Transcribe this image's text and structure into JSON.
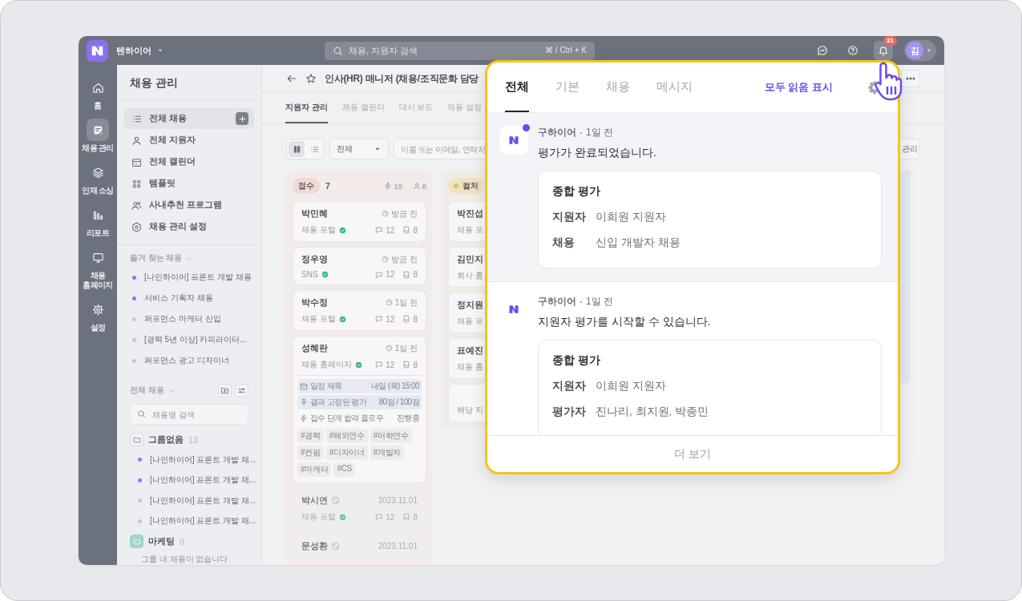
{
  "top_bar": {
    "workspace": "텐하이어",
    "search": {
      "placeholder": "채용, 지원자 검색",
      "shortcut": "⌘ / Ctrl + K"
    },
    "notification_count": "31",
    "avatar": "김"
  },
  "rail": [
    {
      "label": "홈",
      "selected": false
    },
    {
      "label": "채용 관리",
      "selected": true
    },
    {
      "label": "인재 소싱",
      "selected": false
    },
    {
      "label": "리포트",
      "selected": false
    },
    {
      "label": "채용 홈페이지",
      "selected": false
    },
    {
      "label": "설정",
      "selected": false
    }
  ],
  "sidebar": {
    "title": "채용 관리",
    "nav": [
      {
        "label": "전체 채용",
        "selected": true
      },
      {
        "label": "전체 지원자",
        "selected": false
      },
      {
        "label": "전체 캘린더",
        "selected": false
      },
      {
        "label": "템플릿",
        "selected": false
      },
      {
        "label": "사내추천 프로그램",
        "selected": false
      },
      {
        "label": "채용 관리 설정",
        "selected": false
      }
    ],
    "favorites": {
      "title": "즐겨 찾는 채용",
      "items": [
        {
          "label": "[나인하이어] 프론트 개발 채용",
          "color": "#8b7cf6"
        },
        {
          "label": "서비스 기획자 채용",
          "color": "#8b7cf6"
        },
        {
          "label": "퍼포먼스 마케터 신입",
          "color": "#c4c7cd"
        },
        {
          "label": "[경력 5년 이상] 카피라이터...",
          "color": "#c4c7cd"
        },
        {
          "label": "퍼포먼스 광고 디자이너",
          "color": "#c4c7cd"
        }
      ]
    },
    "all_jobs": {
      "title": "전체 채용",
      "search_placeholder": "채용명 검색",
      "groups": [
        {
          "name": "그룹없음",
          "count": "13",
          "kind": "plain",
          "items": [
            {
              "label": "[나인하이어] 프론트 개발 채...",
              "color": "#8b7cf6"
            },
            {
              "label": "[나인하이어] 프론트 개발 채...",
              "color": "#8b7cf6"
            },
            {
              "label": "[나인하이어] 프론트 개발 채...",
              "color": "#c4c7cd"
            },
            {
              "label": "[나인하이어] 프론트 개발 채...",
              "color": "#c4c7cd"
            }
          ]
        },
        {
          "name": "마케팅",
          "count": "0",
          "kind": "colored",
          "empty_text": "그룹 내 채용이 없습니다"
        }
      ]
    }
  },
  "page": {
    "title": "인사(HR) 매니저 (채용/조직문화 담당",
    "tabs": [
      {
        "label": "지원자 관리",
        "selected": true
      },
      {
        "label": "채용 캘린더",
        "selected": false
      },
      {
        "label": "대시 보드",
        "selected": false
      },
      {
        "label": "채용 설정",
        "selected": false
      }
    ],
    "toolbar": {
      "views": [
        {
          "selected": true
        },
        {
          "selected": false
        }
      ],
      "filter": "전체",
      "search_placeholder": "이름 또는 이메일, 연락처",
      "manage_button": "관리"
    },
    "columns": [
      {
        "stage": "접수",
        "color": "#f1d9d6",
        "count": "7",
        "automations": "10",
        "assignees": "8",
        "cards": [
          {
            "kind": "applicant",
            "name": "박민혜",
            "time": "방금 전",
            "source": "채용 포털",
            "verified": true,
            "comments": "12",
            "files": "8",
            "disabled": false
          },
          {
            "kind": "applicant",
            "name": "정우영",
            "time": "방금 전",
            "source": "SNS",
            "verified": true,
            "comments": "12",
            "files": "8",
            "disabled": false
          },
          {
            "kind": "applicant",
            "name": "박수정",
            "time": "1일 전",
            "source": "채용 포털",
            "verified": true,
            "comments": "12",
            "files": "8",
            "disabled": false
          },
          {
            "kind": "applicant",
            "name": "성혜란",
            "time": "1일 전",
            "source": "채용 홈페이지",
            "verified": true,
            "comments": "12",
            "files": "8",
            "disabled": false,
            "details": {
              "schedule": {
                "title": "일정 제목",
                "when": "내일 (목) 15:00"
              },
              "evaluation": {
                "title": "결과 고정된 평가",
                "score": "80점 / 100점"
              },
              "flow": {
                "title": "접수 단계 합격 플로우",
                "status": "진행중"
              },
              "tags": [
                "#경력",
                "#해외연수",
                "#어학연수",
                "#컨펌",
                "#디자이너",
                "#개발자",
                "#마케터",
                "#CS"
              ]
            }
          },
          {
            "kind": "applicant",
            "name": "박시연",
            "time": "2023.11.01",
            "source": "채용 포털",
            "verified": true,
            "comments": "12",
            "files": "8",
            "disabled": true
          },
          {
            "kind": "applicant",
            "name": "문성환",
            "time": "2023.11.01",
            "disabled": true
          }
        ]
      },
      {
        "stage": "컬처",
        "color": "#e2c25c",
        "cards": [
          {
            "kind": "applicant",
            "name": "박진섭",
            "source": "채용 포",
            "disabled": false
          },
          {
            "kind": "applicant",
            "name": "김민지",
            "source": "회사 홈",
            "disabled": false
          },
          {
            "kind": "applicant",
            "name": "정지원",
            "source": "채용 포",
            "disabled": false
          },
          {
            "kind": "applicant",
            "name": "표예진",
            "source": "채용 홈",
            "disabled": false
          },
          {
            "kind": "empty",
            "text": "해당 지"
          }
        ]
      }
    ]
  },
  "notifications": {
    "tabs": [
      {
        "label": "전체",
        "selected": true
      },
      {
        "label": "기본",
        "selected": false
      },
      {
        "label": "채용",
        "selected": false
      },
      {
        "label": "메시지",
        "selected": false
      }
    ],
    "mark_all_read": "모두 읽음 표시",
    "items": [
      {
        "sender": "구하이어",
        "time": "1일 전",
        "message": "평가가 완료되었습니다.",
        "unread": true,
        "card": {
          "title": "종합 평가",
          "fields": [
            {
              "label": "지원자",
              "value": "이희원 지원자"
            },
            {
              "label": "채용",
              "value": "신입 개발자 채용"
            }
          ]
        }
      },
      {
        "sender": "구하이어",
        "time": "1일 전",
        "message": "지원자 평가를 시작할 수 있습니다.",
        "unread": false,
        "card": {
          "title": "종합 평가",
          "fields": [
            {
              "label": "지원자",
              "value": "이희원 지원자"
            },
            {
              "label": "평가자",
              "value": "진나리, 최지원, 박종민"
            }
          ]
        }
      }
    ],
    "more": "더 보기"
  }
}
